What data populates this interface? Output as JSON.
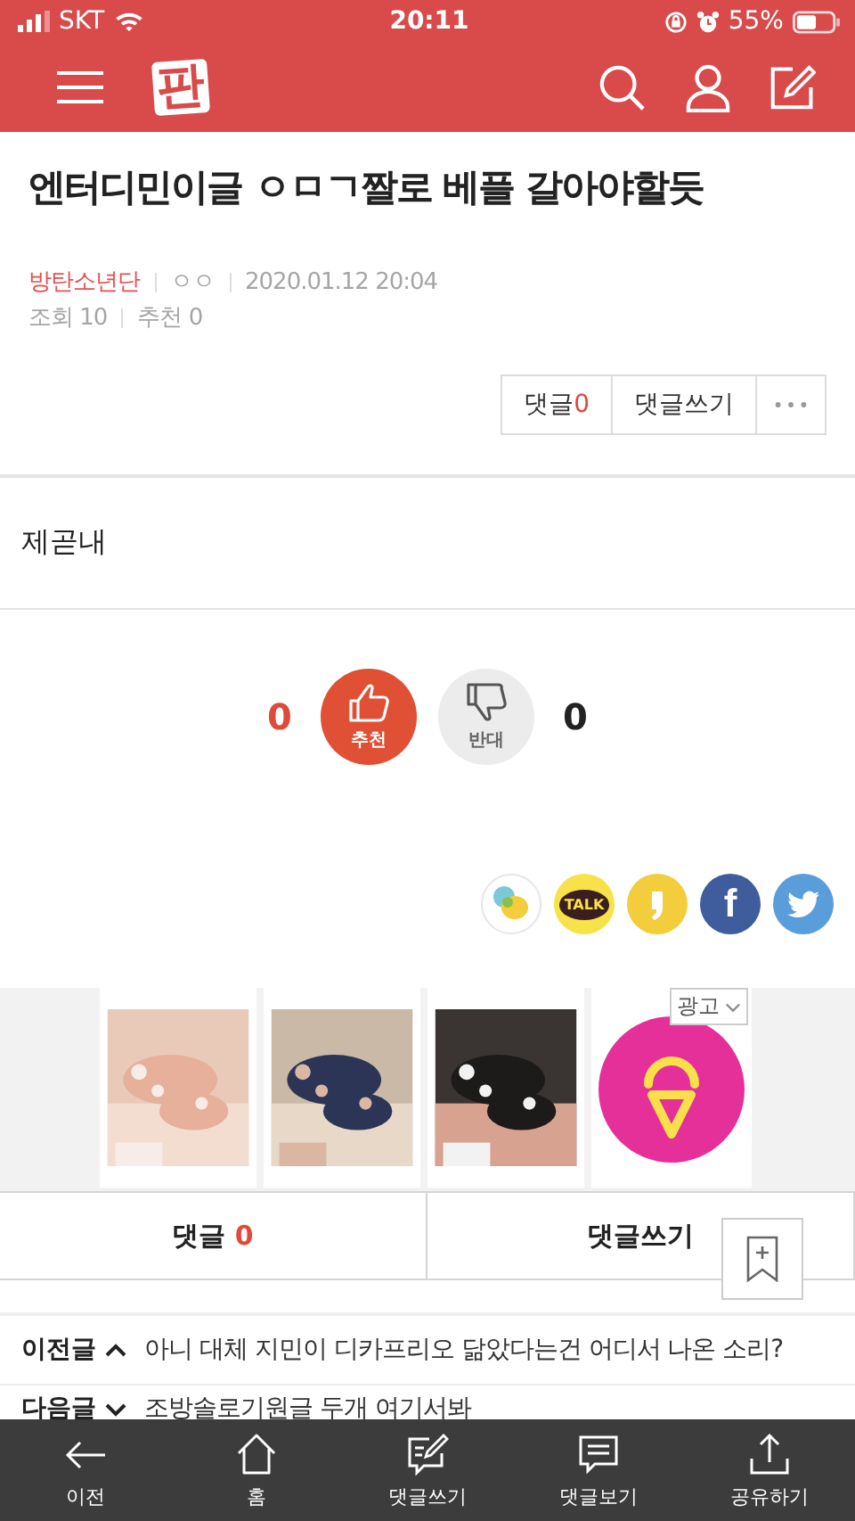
{
  "status_bar": {
    "carrier": "SKT",
    "time": "20:11",
    "battery": "55%"
  },
  "header": {
    "logo": "판"
  },
  "post": {
    "title": "엔터디민이글 ㅇㅁㄱ짤로 베플 갈아야할듯",
    "board": "방탄소년단",
    "author": "ㅇㅇ",
    "date": "2020.01.12 20:04",
    "views": "조회 10",
    "recommends": "추천 0",
    "body": "제곧내"
  },
  "actions": {
    "comment_label": "댓글",
    "comment_count": "0",
    "write": "댓글쓰기"
  },
  "votes": {
    "up_count": "0",
    "up_label": "추천",
    "down_label": "반대",
    "down_count": "0"
  },
  "share": [
    {
      "kind": "bubbles"
    },
    {
      "kind": "talk",
      "label": "TALK"
    },
    {
      "kind": "story"
    },
    {
      "kind": "facebook",
      "label": "f"
    },
    {
      "kind": "twitter"
    }
  ],
  "ad": {
    "label": "광고",
    "tiles": [
      {
        "kind": "picture"
      },
      {
        "kind": "picture"
      },
      {
        "kind": "picture"
      },
      {
        "kind": "logo"
      }
    ]
  },
  "comment_bar": {
    "comment_label": "댓글",
    "comment_count": "0",
    "write": "댓글쓰기"
  },
  "adjacent_posts": [
    {
      "label": "이전글",
      "kind": "up",
      "title": "아니 대체 지민이 디카프리오 닮았다는건 어디서 나온 소리?"
    },
    {
      "label": "다음글",
      "kind": "down",
      "title": "조방솔로기원글 두개 여기서봐"
    }
  ],
  "bottom_nav": [
    {
      "kind": "back",
      "label": "이전"
    },
    {
      "kind": "home",
      "label": "홈"
    },
    {
      "kind": "write",
      "label": "댓글쓰기"
    },
    {
      "kind": "comments",
      "label": "댓글보기"
    },
    {
      "kind": "share",
      "label": "공유하기"
    }
  ]
}
